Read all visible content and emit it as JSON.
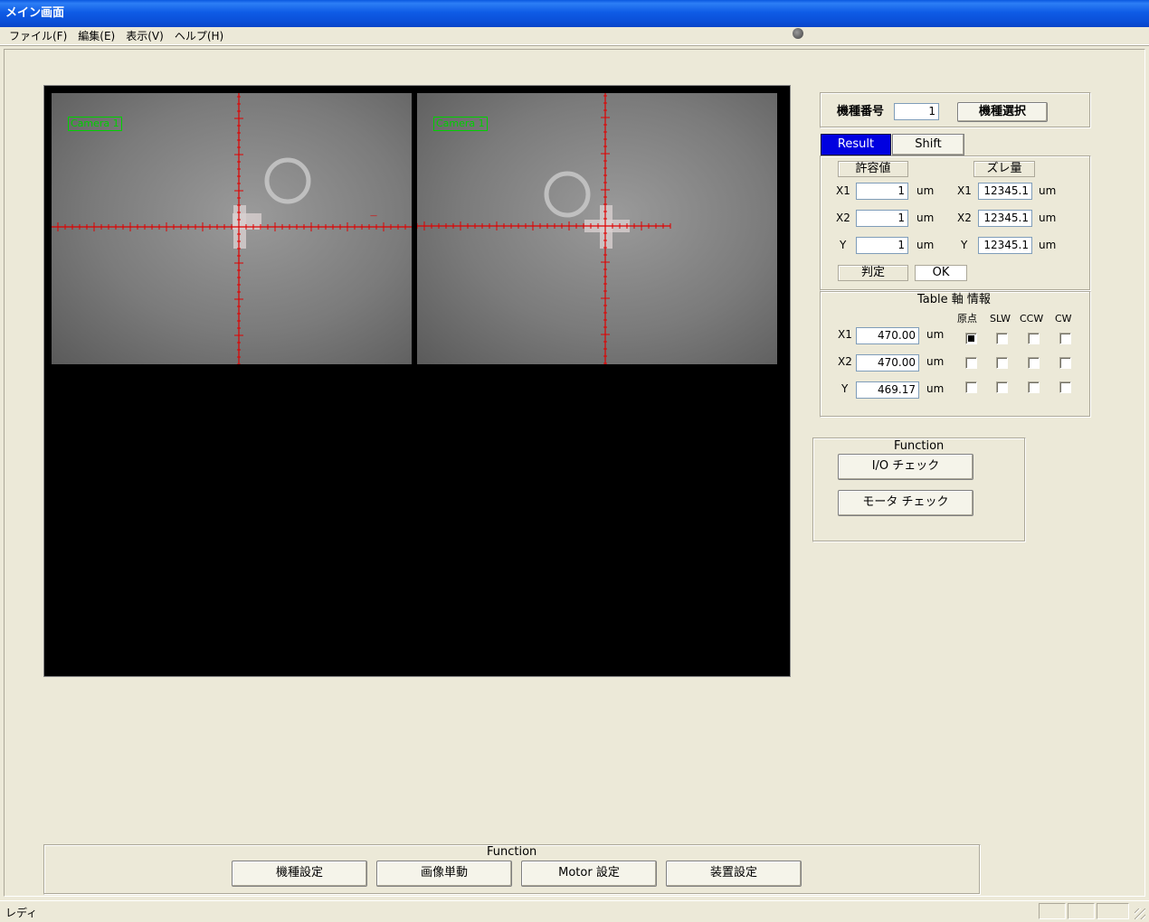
{
  "window": {
    "title": "メイン画面"
  },
  "menu": [
    "ファイル(F)",
    "編集(E)",
    "表示(V)",
    "ヘルプ(H)"
  ],
  "cameras": [
    {
      "label": "Camera 1"
    },
    {
      "label": "Camera 1"
    }
  ],
  "model": {
    "label": "機種番号",
    "value": "1",
    "select_button": "機種選択"
  },
  "tabs": {
    "result": "Result",
    "shift": "Shift"
  },
  "result_panel": {
    "tolerance_header": "許容値",
    "deviation_header": "ズレ量",
    "unit": "um",
    "rows": [
      {
        "axis": "X1",
        "tolerance": "1",
        "deviation": "12345.1"
      },
      {
        "axis": "X2",
        "tolerance": "1",
        "deviation": "12345.1"
      },
      {
        "axis": "Y",
        "tolerance": "1",
        "deviation": "12345.1"
      }
    ],
    "judge_label": "判定",
    "judge_value": "OK"
  },
  "table_axis": {
    "title": "Table 軸 情報",
    "columns": [
      "原点",
      "SLW",
      "CCW",
      "CW"
    ],
    "unit": "um",
    "rows": [
      {
        "axis": "X1",
        "value": "470.00",
        "states": [
          true,
          false,
          false,
          false
        ]
      },
      {
        "axis": "X2",
        "value": "470.00",
        "states": [
          false,
          false,
          false,
          false
        ]
      },
      {
        "axis": "Y",
        "value": "469.17",
        "states": [
          false,
          false,
          false,
          false
        ]
      }
    ]
  },
  "function_right": {
    "title": "Function",
    "buttons": [
      "I/O チェック",
      "モータ チェック"
    ]
  },
  "function_bottom": {
    "title": "Function",
    "buttons": [
      "機種設定",
      "画像単動",
      "Motor 設定",
      "装置設定"
    ]
  },
  "status": {
    "text": "レディ"
  },
  "colors": {
    "active_tab": "#0000E0",
    "cam_label": "#00D000",
    "crosshair": "#E00000"
  }
}
